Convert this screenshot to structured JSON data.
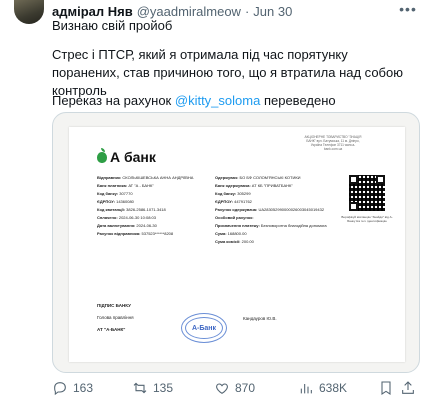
{
  "tweet": {
    "name": "адмірал Няв",
    "handle": "@yaadmiralmeow",
    "separator": "·",
    "date": "Jun 30",
    "line1": "Визнаю свій пройоб",
    "para": "Стрес і ПТСР, який я отримала під час порятунку поранених, став причиною того, що я втратила над собою контроль",
    "transfer_prefix": "Переказ на рахунок",
    "transfer_link": "@kitty_soloma",
    "transfer_suffix": "переведено"
  },
  "receipt": {
    "logo_text": "А банк",
    "bank_header": "АКЦІОНЕРНЕ ТОВАРИСТВО \"ЗНАЦІЯ БАНК\" вул. Батумська, 11 м. Дніпро, Україна Телефон 3711 www.a-bank.com.ua",
    "left_fields": [
      {
        "label": "Відправник:",
        "value": "СКОЛЬКІШЕВСЬКА АННА АНДРІЇВНА"
      },
      {
        "label": "Банк платника:",
        "value": "АТ \"А - БАНК\""
      },
      {
        "label": "Код банку:",
        "value": "307770"
      },
      {
        "label": "ЄДРПОУ:",
        "value": "14360080"
      },
      {
        "label": "Код квитанції:",
        "value": "3826-2586-1071-3418"
      },
      {
        "label": "Сплачено:",
        "value": "2024-06-30 10:08:03"
      },
      {
        "label": "Дата валютування:",
        "value": "2024-06-30"
      },
      {
        "label": "Рахунок відправника:",
        "value": "537523******8208"
      }
    ],
    "right_fields": [
      {
        "label": "Одержувач:",
        "value": "БО БФ СОЛОМ'ЯНСЬКІ КОТИКИ"
      },
      {
        "label": "Банк одержувача:",
        "value": "АТ КБ \"ПРИВАТБАНК\""
      },
      {
        "label": "Код банку:",
        "value": "305299"
      },
      {
        "label": "ЄДРПОУ:",
        "value": "44791762"
      },
      {
        "label": "Рахунок одержувача:",
        "value": "UA283052990000026003045019432"
      },
      {
        "label": "Особовий рахунок:",
        "value": ""
      },
      {
        "label": "Призначення платежу:",
        "value": "Безповоротна благодійна допомога"
      },
      {
        "label": "Сума:",
        "value": "168800.00"
      },
      {
        "label": "Сума комісії:",
        "value": "200.00"
      }
    ],
    "qr_caption": "Верифікуй квитанцію \"Знайди\" від А-Банку На тел. ідентифікацію",
    "sign_title": "ПІДПИС БАНКУ",
    "sign_role": "Голова правління",
    "sign_org": "АТ \"А-БАНК\"",
    "sign_name": "Кандауров Ю.В.",
    "stamp_text": "А-Банк"
  },
  "actions": {
    "replies": "163",
    "retweets": "135",
    "likes": "870",
    "views": "638K"
  }
}
